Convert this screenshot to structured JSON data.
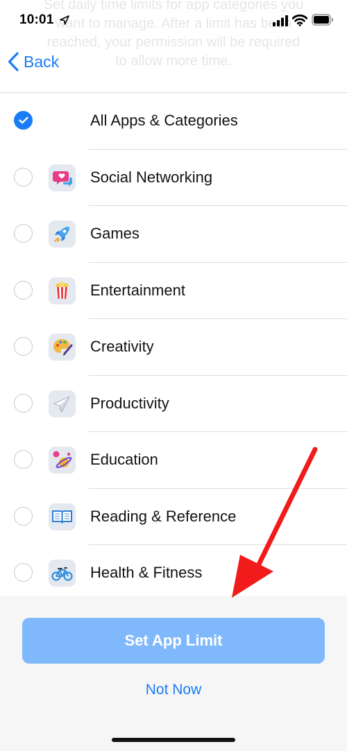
{
  "header": {
    "description_lines": [
      "Set daily time limits for app categories you",
      "want to manage. After a limit has been",
      "reached, your permission will be required",
      "to allow more time."
    ]
  },
  "status_bar": {
    "time": "10:01",
    "icons": [
      "location-arrow-icon",
      "cellular-signal-icon",
      "wifi-icon",
      "battery-icon"
    ]
  },
  "nav": {
    "back_label": "Back",
    "back_icon": "chevron-left-icon"
  },
  "categories": [
    {
      "label": "All Apps & Categories",
      "selected": true,
      "icon": null
    },
    {
      "label": "Social Networking",
      "selected": false,
      "icon": "social-networking-icon"
    },
    {
      "label": "Games",
      "selected": false,
      "icon": "games-rocket-icon"
    },
    {
      "label": "Entertainment",
      "selected": false,
      "icon": "entertainment-popcorn-icon"
    },
    {
      "label": "Creativity",
      "selected": false,
      "icon": "creativity-palette-icon"
    },
    {
      "label": "Productivity",
      "selected": false,
      "icon": "productivity-paper-plane-icon"
    },
    {
      "label": "Education",
      "selected": false,
      "icon": "education-planet-icon"
    },
    {
      "label": "Reading & Reference",
      "selected": false,
      "icon": "reading-book-icon"
    },
    {
      "label": "Health & Fitness",
      "selected": false,
      "icon": "health-bicycle-icon"
    }
  ],
  "actions": {
    "primary_label": "Set App Limit",
    "secondary_label": "Not Now"
  },
  "colors": {
    "accent": "#1a7cf6",
    "primary_button_disabled": "#80b9fb",
    "annotation_arrow": "#f21b1b"
  }
}
